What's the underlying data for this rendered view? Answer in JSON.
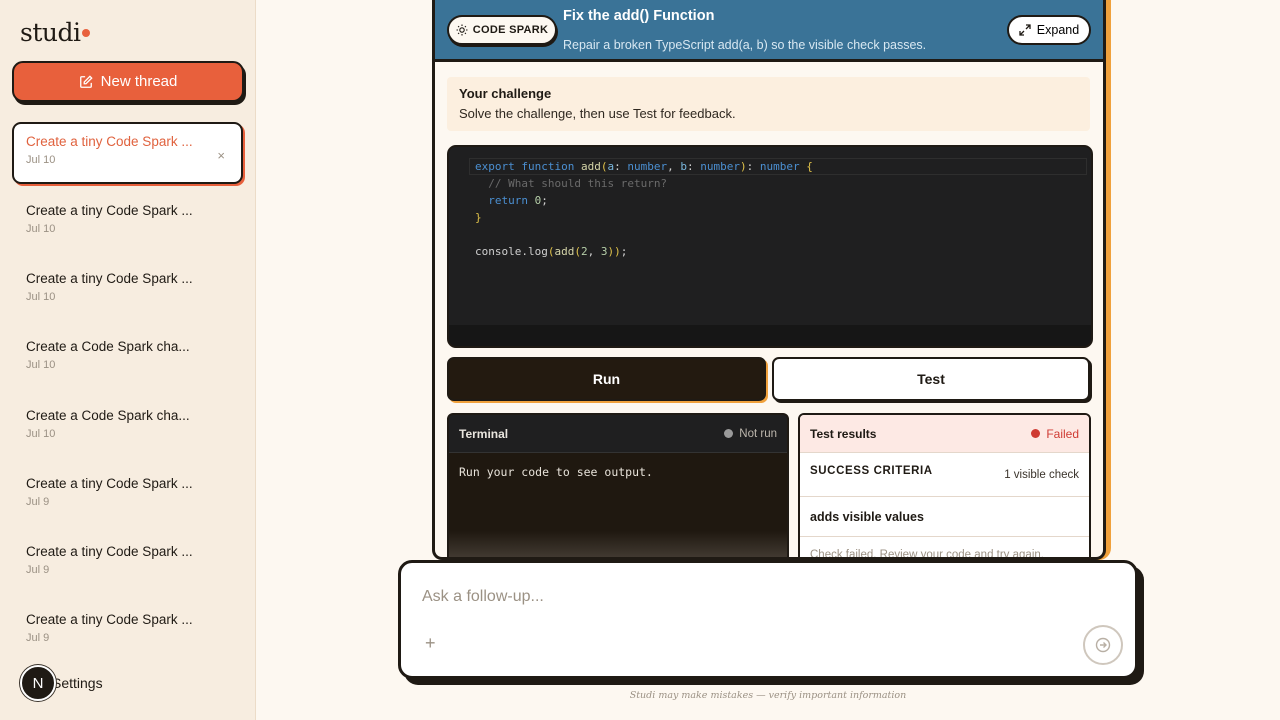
{
  "sidebar": {
    "brand": "studi",
    "new_thread_label": "New thread",
    "threads": [
      {
        "title": "Create a tiny Code Spark ...",
        "date": "Jul 10"
      },
      {
        "title": "Create a tiny Code Spark ...",
        "date": "Jul 10"
      },
      {
        "title": "Create a tiny Code Spark ...",
        "date": "Jul 10"
      },
      {
        "title": "Create a Code Spark cha...",
        "date": "Jul 10"
      },
      {
        "title": "Create a Code Spark cha...",
        "date": "Jul 10"
      },
      {
        "title": "Create a tiny Code Spark ...",
        "date": "Jul 9"
      },
      {
        "title": "Create a tiny Code Spark ...",
        "date": "Jul 9"
      },
      {
        "title": "Create a tiny Code Spark ...",
        "date": "Jul 9"
      }
    ],
    "close_glyph": "×",
    "avatar_initial": "N",
    "settings_label": "Settings"
  },
  "widget": {
    "badge": "CODE SPARK",
    "title": "Fix the add() Function",
    "subtitle": "Repair a broken TypeScript add(a, b) so the visible check passes.",
    "expand_label": "Expand",
    "challenge_heading": "Your challenge",
    "challenge_text": "Solve the challenge, then use Test for feedback.",
    "code": {
      "l1_kw1": "export",
      "l1_kw2": "function",
      "l1_fn": "add",
      "l1_a": "a",
      "l1_b": "b",
      "l1_t1": "number",
      "l1_t2": "number",
      "l1_t3": "number",
      "l2": "// What should this return?",
      "l3_kw": "return",
      "l3_num": "0",
      "l5_obj": "console.log",
      "l5_fn": "add",
      "l5_n1": "2",
      "l5_n2": "3"
    },
    "run_label": "Run",
    "test_label": "Test",
    "terminal": {
      "title": "Terminal",
      "status": "Not run",
      "output": "Run your code to see output."
    },
    "results": {
      "title": "Test results",
      "status": "Failed",
      "criteria_heading": "SUCCESS CRITERIA",
      "criteria_count": "1 visible check",
      "case_name": "adds visible values",
      "case_message": "Check failed. Review your code and try again."
    }
  },
  "composer": {
    "placeholder": "Ask a follow-up...",
    "plus_glyph": "+",
    "disclaimer": "Studi may make mistakes — verify important information"
  },
  "colors": {
    "accent": "#e8603c",
    "header_blue": "#3a7397",
    "shadow_orange": "#f0a13c",
    "ink": "#1f1a14",
    "failed_red": "#cf3b33"
  }
}
